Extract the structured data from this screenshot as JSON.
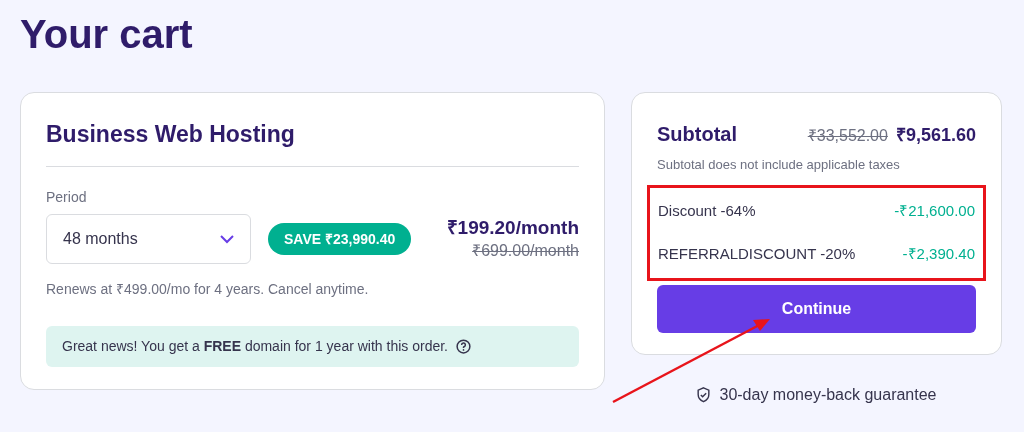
{
  "page_title": "Your cart",
  "product": {
    "title": "Business Web Hosting",
    "period_label": "Period",
    "period_value": "48 months",
    "save_badge": "SAVE ₹23,990.40",
    "price": "₹199.20/month",
    "old_price": "₹699.00/month",
    "renewal_note": "Renews at ₹499.00/mo for 4 years. Cancel anytime.",
    "domain_note": "Great news! You get a **FREE** domain for 1 year with this order."
  },
  "summary": {
    "title": "Subtotal",
    "old_total": "₹33,552.00",
    "total": "₹9,561.60",
    "tax_note": "Subtotal does not include applicable taxes",
    "discounts": [
      {
        "label": "Discount -64%",
        "amount": "-₹21,600.00"
      },
      {
        "label": "REFERRALDISCOUNT -20%",
        "amount": "-₹2,390.40"
      }
    ],
    "button": "Continue"
  },
  "guarantee": "30-day money-back guarantee"
}
